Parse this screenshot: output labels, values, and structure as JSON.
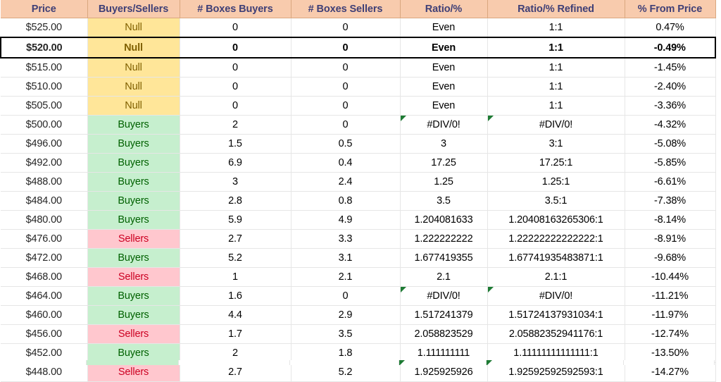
{
  "table": {
    "columns": [
      "Price",
      "Buyers/Sellers",
      "# Boxes Buyers",
      "# Boxes Sellers",
      "Ratio/%",
      "Ratio/% Refined",
      "% From Price"
    ],
    "colors": {
      "header_bg": "#F8CBAD",
      "header_text": "#3F3F76",
      "null_bg": "#FFE699",
      "null_text": "#806000",
      "buyers_bg": "#C6EFCE",
      "buyers_text": "#006100",
      "sellers_bg": "#FFC7CE",
      "sellers_text": "#CC0022",
      "comment_marker": "#1E7B34",
      "selected_border": "#000000"
    },
    "rows": [
      {
        "price": "$525.00",
        "side": "Null",
        "side_kind": "null",
        "boxes_buyers": "0",
        "boxes_sellers": "0",
        "ratio": "Even",
        "ratio_refined": "1:1",
        "pct_from_price": "0.47%",
        "selected": false,
        "ratio_marker": false,
        "refined_marker": false
      },
      {
        "price": "$520.00",
        "side": "Null",
        "side_kind": "null",
        "boxes_buyers": "0",
        "boxes_sellers": "0",
        "ratio": "Even",
        "ratio_refined": "1:1",
        "pct_from_price": "-0.49%",
        "selected": true,
        "ratio_marker": false,
        "refined_marker": false
      },
      {
        "price": "$515.00",
        "side": "Null",
        "side_kind": "null",
        "boxes_buyers": "0",
        "boxes_sellers": "0",
        "ratio": "Even",
        "ratio_refined": "1:1",
        "pct_from_price": "-1.45%",
        "selected": false,
        "ratio_marker": false,
        "refined_marker": false
      },
      {
        "price": "$510.00",
        "side": "Null",
        "side_kind": "null",
        "boxes_buyers": "0",
        "boxes_sellers": "0",
        "ratio": "Even",
        "ratio_refined": "1:1",
        "pct_from_price": "-2.40%",
        "selected": false,
        "ratio_marker": false,
        "refined_marker": false
      },
      {
        "price": "$505.00",
        "side": "Null",
        "side_kind": "null",
        "boxes_buyers": "0",
        "boxes_sellers": "0",
        "ratio": "Even",
        "ratio_refined": "1:1",
        "pct_from_price": "-3.36%",
        "selected": false,
        "ratio_marker": false,
        "refined_marker": false
      },
      {
        "price": "$500.00",
        "side": "Buyers",
        "side_kind": "buyers",
        "boxes_buyers": "2",
        "boxes_sellers": "0",
        "ratio": "#DIV/0!",
        "ratio_refined": "#DIV/0!",
        "pct_from_price": "-4.32%",
        "selected": false,
        "ratio_marker": true,
        "refined_marker": true
      },
      {
        "price": "$496.00",
        "side": "Buyers",
        "side_kind": "buyers",
        "boxes_buyers": "1.5",
        "boxes_sellers": "0.5",
        "ratio": "3",
        "ratio_refined": "3:1",
        "pct_from_price": "-5.08%",
        "selected": false,
        "ratio_marker": false,
        "refined_marker": false
      },
      {
        "price": "$492.00",
        "side": "Buyers",
        "side_kind": "buyers",
        "boxes_buyers": "6.9",
        "boxes_sellers": "0.4",
        "ratio": "17.25",
        "ratio_refined": "17.25:1",
        "pct_from_price": "-5.85%",
        "selected": false,
        "ratio_marker": false,
        "refined_marker": false
      },
      {
        "price": "$488.00",
        "side": "Buyers",
        "side_kind": "buyers",
        "boxes_buyers": "3",
        "boxes_sellers": "2.4",
        "ratio": "1.25",
        "ratio_refined": "1.25:1",
        "pct_from_price": "-6.61%",
        "selected": false,
        "ratio_marker": false,
        "refined_marker": false
      },
      {
        "price": "$484.00",
        "side": "Buyers",
        "side_kind": "buyers",
        "boxes_buyers": "2.8",
        "boxes_sellers": "0.8",
        "ratio": "3.5",
        "ratio_refined": "3.5:1",
        "pct_from_price": "-7.38%",
        "selected": false,
        "ratio_marker": false,
        "refined_marker": false
      },
      {
        "price": "$480.00",
        "side": "Buyers",
        "side_kind": "buyers",
        "boxes_buyers": "5.9",
        "boxes_sellers": "4.9",
        "ratio": "1.204081633",
        "ratio_refined": "1.20408163265306:1",
        "pct_from_price": "-8.14%",
        "selected": false,
        "ratio_marker": false,
        "refined_marker": false
      },
      {
        "price": "$476.00",
        "side": "Sellers",
        "side_kind": "sellers",
        "boxes_buyers": "2.7",
        "boxes_sellers": "3.3",
        "ratio": "1.222222222",
        "ratio_refined": "1.22222222222222:1",
        "pct_from_price": "-8.91%",
        "selected": false,
        "ratio_marker": false,
        "refined_marker": false
      },
      {
        "price": "$472.00",
        "side": "Buyers",
        "side_kind": "buyers",
        "boxes_buyers": "5.2",
        "boxes_sellers": "3.1",
        "ratio": "1.677419355",
        "ratio_refined": "1.67741935483871:1",
        "pct_from_price": "-9.68%",
        "selected": false,
        "ratio_marker": false,
        "refined_marker": false
      },
      {
        "price": "$468.00",
        "side": "Sellers",
        "side_kind": "sellers",
        "boxes_buyers": "1",
        "boxes_sellers": "2.1",
        "ratio": "2.1",
        "ratio_refined": "2.1:1",
        "pct_from_price": "-10.44%",
        "selected": false,
        "ratio_marker": false,
        "refined_marker": false
      },
      {
        "price": "$464.00",
        "side": "Buyers",
        "side_kind": "buyers",
        "boxes_buyers": "1.6",
        "boxes_sellers": "0",
        "ratio": "#DIV/0!",
        "ratio_refined": "#DIV/0!",
        "pct_from_price": "-11.21%",
        "selected": false,
        "ratio_marker": true,
        "refined_marker": true
      },
      {
        "price": "$460.00",
        "side": "Buyers",
        "side_kind": "buyers",
        "boxes_buyers": "4.4",
        "boxes_sellers": "2.9",
        "ratio": "1.517241379",
        "ratio_refined": "1.51724137931034:1",
        "pct_from_price": "-11.97%",
        "selected": false,
        "ratio_marker": false,
        "refined_marker": false
      },
      {
        "price": "$456.00",
        "side": "Sellers",
        "side_kind": "sellers",
        "boxes_buyers": "1.7",
        "boxes_sellers": "3.5",
        "ratio": "2.058823529",
        "ratio_refined": "2.05882352941176:1",
        "pct_from_price": "-12.74%",
        "selected": false,
        "ratio_marker": false,
        "refined_marker": false
      },
      {
        "price": "$452.00",
        "side": "Buyers",
        "side_kind": "buyers",
        "boxes_buyers": "2",
        "boxes_sellers": "1.8",
        "ratio": "1.111111111",
        "ratio_refined": "1.11111111111111:1",
        "pct_from_price": "-13.50%",
        "selected": false,
        "ratio_marker": false,
        "refined_marker": false
      },
      {
        "price": "$448.00",
        "side": "Sellers",
        "side_kind": "sellers",
        "boxes_buyers": "2.7",
        "boxes_sellers": "5.2",
        "ratio": "1.925925926",
        "ratio_refined": "1.92592592592593:1",
        "pct_from_price": "-14.27%",
        "selected": false,
        "ratio_marker": false,
        "refined_marker": false
      }
    ],
    "clipped_row": {
      "side_kind": "buyers",
      "ratio_marker": true,
      "refined_marker": true
    }
  }
}
